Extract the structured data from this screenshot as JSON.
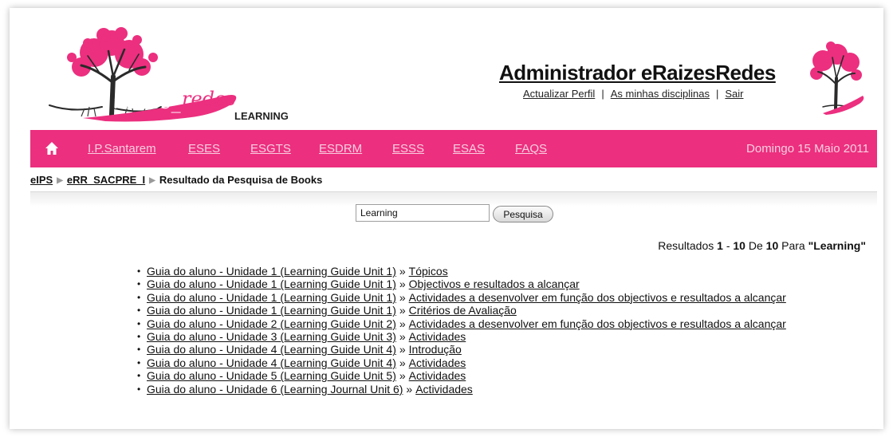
{
  "header": {
    "logo_text": "eRaizes_redes LEARNING",
    "admin_title": "Administrador eRaizesRedes",
    "links": [
      "Actualizar Perfil",
      "As minhas disciplinas",
      "Sair"
    ],
    "link_separator": "|"
  },
  "nav": {
    "home_icon": "home-icon",
    "items": [
      "I.P.Santarem",
      "ESES",
      "ESGTS",
      "ESDRM",
      "ESSS",
      "ESAS",
      "FAQS"
    ],
    "date": "Domingo 15 Maio 2011",
    "bg_color": "#ec2f7f"
  },
  "breadcrumb": {
    "items": [
      "eIPS",
      "eRR_SACPRE_I"
    ],
    "current": "Resultado da Pesquisa de Books",
    "separator": "▶"
  },
  "search": {
    "value": "Learning",
    "button": "Pesquisa"
  },
  "summary": {
    "prefix": "Resultados",
    "from": "1",
    "dash": "-",
    "to": "10",
    "of_label": "De",
    "total": "10",
    "for_label": "Para",
    "query": "\"Learning\""
  },
  "results": {
    "separator": "»",
    "items": [
      {
        "book": "Guia do aluno - Unidade 1 (Learning Guide Unit 1)",
        "chapter": "Tópicos"
      },
      {
        "book": "Guia do aluno - Unidade 1 (Learning Guide Unit 1)",
        "chapter": "Objectivos e resultados a alcançar"
      },
      {
        "book": "Guia do aluno - Unidade 1 (Learning Guide Unit 1)",
        "chapter": "Actividades a desenvolver em função dos objectivos e resultados a alcançar"
      },
      {
        "book": "Guia do aluno - Unidade 1 (Learning Guide Unit 1)",
        "chapter": "Critérios de Avaliação"
      },
      {
        "book": "Guia do aluno - Unidade 2 (Learning Guide Unit 2)",
        "chapter": "Actividades a desenvolver em função dos objectivos e resultados a alcançar"
      },
      {
        "book": "Guia do aluno - Unidade 3 (Learning Guide Unit 3)",
        "chapter": "Actividades"
      },
      {
        "book": "Guia do aluno - Unidade 4 (Learning Guide Unit 4)",
        "chapter": "Introdução"
      },
      {
        "book": "Guia do aluno - Unidade 4 (Learning Guide Unit 4)",
        "chapter": "Actividades"
      },
      {
        "book": "Guia do aluno - Unidade 5 (Learning Guide Unit 5)",
        "chapter": "Actividades"
      },
      {
        "book": "Guia do aluno - Unidade 6 (Learning Journal Unit 6)",
        "chapter": "Actividades"
      }
    ]
  }
}
